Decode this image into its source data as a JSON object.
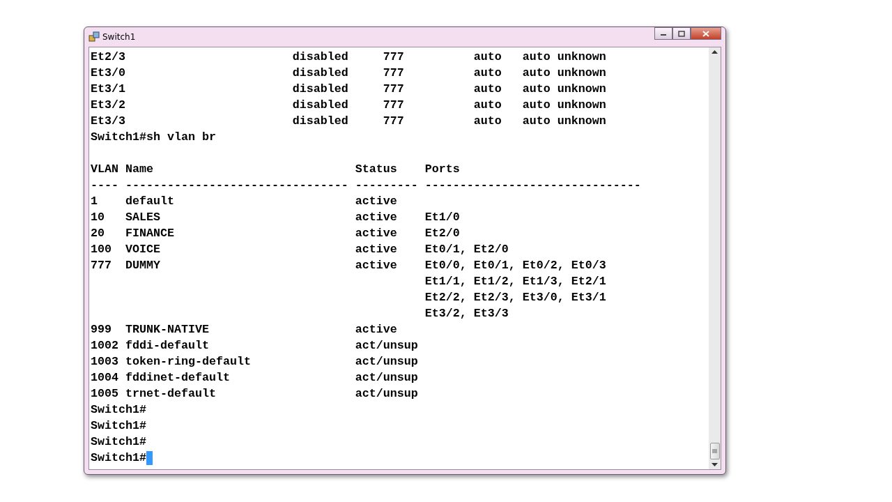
{
  "window": {
    "title": "Switch1"
  },
  "terminal": {
    "lines": [
      {
        "kind": "text",
        "text": "Et2/3                        disabled     777          auto   auto unknown",
        "cursor": false
      },
      {
        "kind": "text",
        "text": "Et3/0                        disabled     777          auto   auto unknown",
        "cursor": false
      },
      {
        "kind": "text",
        "text": "Et3/1                        disabled     777          auto   auto unknown",
        "cursor": false
      },
      {
        "kind": "text",
        "text": "Et3/2                        disabled     777          auto   auto unknown",
        "cursor": false
      },
      {
        "kind": "text",
        "text": "Et3/3                        disabled     777          auto   auto unknown",
        "cursor": false
      },
      {
        "kind": "text",
        "text": "Switch1#sh vlan br",
        "cursor": false
      },
      {
        "kind": "blank"
      },
      {
        "kind": "text",
        "text": "VLAN Name                             Status    Ports",
        "cursor": false
      },
      {
        "kind": "text",
        "text": "---- -------------------------------- --------- -------------------------------",
        "cursor": false
      },
      {
        "kind": "text",
        "text": "1    default                          active",
        "cursor": false
      },
      {
        "kind": "text",
        "text": "10   SALES                            active    Et1/0",
        "cursor": false
      },
      {
        "kind": "text",
        "text": "20   FINANCE                          active    Et2/0",
        "cursor": false
      },
      {
        "kind": "text",
        "text": "100  VOICE                            active    Et0/1, Et2/0",
        "cursor": false
      },
      {
        "kind": "text",
        "text": "777  DUMMY                            active    Et0/0, Et0/1, Et0/2, Et0/3",
        "cursor": false
      },
      {
        "kind": "text",
        "text": "                                                Et1/1, Et1/2, Et1/3, Et2/1",
        "cursor": false
      },
      {
        "kind": "text",
        "text": "                                                Et2/2, Et2/3, Et3/0, Et3/1",
        "cursor": false
      },
      {
        "kind": "text",
        "text": "                                                Et3/2, Et3/3",
        "cursor": false
      },
      {
        "kind": "text",
        "text": "999  TRUNK-NATIVE                     active",
        "cursor": false
      },
      {
        "kind": "text",
        "text": "1002 fddi-default                     act/unsup",
        "cursor": false
      },
      {
        "kind": "text",
        "text": "1003 token-ring-default               act/unsup",
        "cursor": false
      },
      {
        "kind": "text",
        "text": "1004 fddinet-default                  act/unsup",
        "cursor": false
      },
      {
        "kind": "text",
        "text": "1005 trnet-default                    act/unsup",
        "cursor": false
      },
      {
        "kind": "text",
        "text": "Switch1#",
        "cursor": false
      },
      {
        "kind": "text",
        "text": "Switch1#",
        "cursor": false
      },
      {
        "kind": "text",
        "text": "Switch1#",
        "cursor": false
      },
      {
        "kind": "text",
        "text": "Switch1#",
        "cursor": true
      }
    ]
  }
}
